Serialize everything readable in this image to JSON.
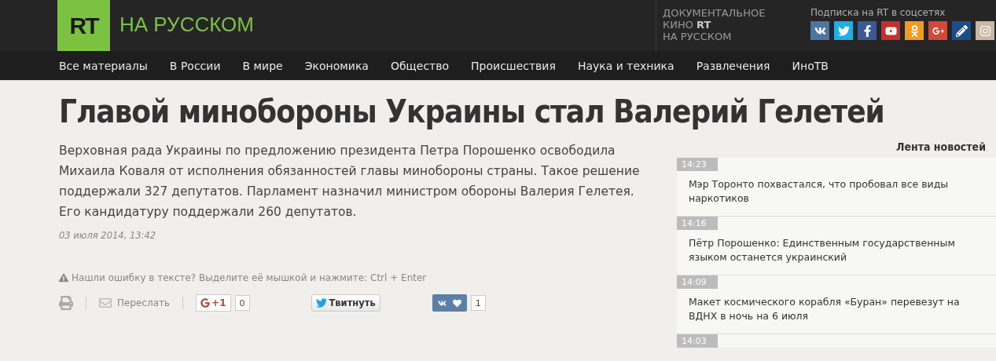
{
  "header": {
    "logo_mark": "RT",
    "logo_text": "НА РУССКОМ",
    "doc": {
      "line1": "ДОКУМЕНТАЛЬНОЕ",
      "line2": "КИНО",
      "mark": "RT",
      "line3": "НА РУССКОМ"
    },
    "social_title": "Подписка на RT в соцсетях",
    "social": [
      {
        "kind": "vk",
        "color": "#4c75a3"
      },
      {
        "kind": "twitter",
        "color": "#1eaee8"
      },
      {
        "kind": "facebook",
        "color": "#3b5998"
      },
      {
        "kind": "youtube",
        "color": "#c4302b"
      },
      {
        "kind": "ok",
        "color": "#f59a1a"
      },
      {
        "kind": "gplus",
        "color": "#d34836"
      },
      {
        "kind": "livejournal",
        "color": "#1d4c8a"
      },
      {
        "kind": "instagram",
        "color": "#c8b8a4"
      }
    ]
  },
  "nav": [
    {
      "label": "Все материалы"
    },
    {
      "label": "В России"
    },
    {
      "label": "В мире"
    },
    {
      "label": "Экономика"
    },
    {
      "label": "Общество"
    },
    {
      "label": "Происшествия"
    },
    {
      "label": "Наука и техника"
    },
    {
      "label": "Развлечения"
    },
    {
      "label": "ИноТВ"
    }
  ],
  "article": {
    "title": "Главой минобороны Украины стал Валерий Гелетей",
    "lead": "Верховная рада Украины по предложению президента Петра Порошенко освободила Михаила Коваля от исполнения обязанностей главы минобороны страны. Такое решение поддержали 327 депутатов. Парламент назначил министром обороны Валерия Гелетея. Его кандидатуру поддержали 260 депутатов.",
    "date": "03 июля 2014, 13:42",
    "error_hint": "Нашли ошибку в тексте? Выделите её мышкой и нажмите: Ctrl + Enter",
    "share": {
      "forward": "Переслать",
      "gplus": "+1",
      "gplus_count": "0",
      "tweet": "Твитнуть",
      "vk_count": "1"
    }
  },
  "news_feed": {
    "title": "Лента новостей",
    "items": [
      {
        "time": "14:23",
        "title": "Мэр Торонто похвастался, что пробовал все виды наркотиков"
      },
      {
        "time": "14:16",
        "title": "Пётр Порошенко: Единственным государственным языком останется украинский"
      },
      {
        "time": "14:09",
        "title": "Макет космического корабля «Буран» перевезут на ВДНХ в ночь на 6 июля"
      },
      {
        "time": "14:03"
      }
    ]
  }
}
